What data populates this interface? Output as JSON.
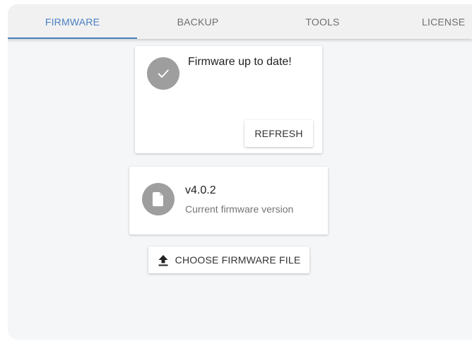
{
  "tabs": [
    {
      "label": "FIRMWARE",
      "active": true
    },
    {
      "label": "BACKUP",
      "active": false
    },
    {
      "label": "TOOLS",
      "active": false
    },
    {
      "label": "LICENSE",
      "active": false
    }
  ],
  "status_card": {
    "icon": "check-icon",
    "message": "Firmware up to date!",
    "refresh_label": "REFRESH"
  },
  "version_card": {
    "icon": "file-icon",
    "version": "v4.0.2",
    "caption": "Current firmware version"
  },
  "upload": {
    "icon": "upload-icon",
    "label": "CHOOSE FIRMWARE FILE"
  },
  "colors": {
    "accent": "#4a7fc1",
    "icon_bg": "#9e9e9e",
    "background": "#f4f6f8"
  }
}
